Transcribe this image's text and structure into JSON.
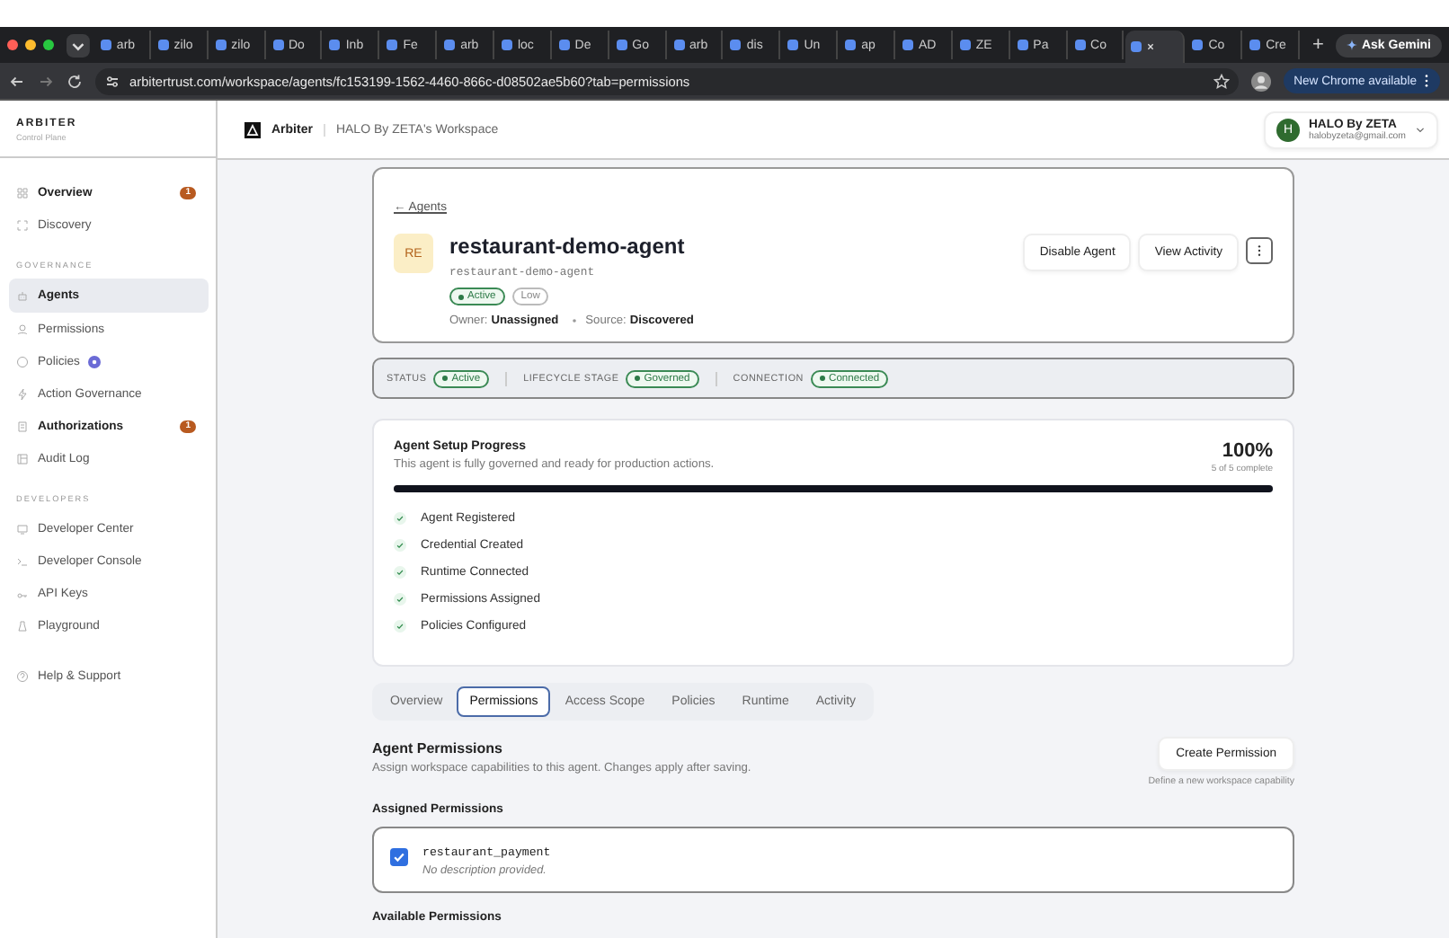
{
  "browser": {
    "tabs": [
      {
        "label": "arb",
        "selected": false
      },
      {
        "label": "zilo",
        "selected": false
      },
      {
        "label": "zilo",
        "selected": false
      },
      {
        "label": "Do",
        "selected": false
      },
      {
        "label": "Inb",
        "selected": false
      },
      {
        "label": "Fe",
        "selected": false
      },
      {
        "label": "arb",
        "selected": false
      },
      {
        "label": "loc",
        "selected": false
      },
      {
        "label": "De",
        "selected": false
      },
      {
        "label": "Go",
        "selected": false
      },
      {
        "label": "arb",
        "selected": false
      },
      {
        "label": "dis",
        "selected": false
      },
      {
        "label": "Un",
        "selected": false
      },
      {
        "label": "ap",
        "selected": false
      },
      {
        "label": "AD",
        "selected": false
      },
      {
        "label": "ZE",
        "selected": false
      },
      {
        "label": "Pa",
        "selected": false
      },
      {
        "label": "Co",
        "selected": false
      },
      {
        "selected": true
      },
      {
        "label": "Co",
        "selected": false
      },
      {
        "label": "Cre",
        "selected": false
      }
    ],
    "new_tab": "+",
    "ask_gemini": "Ask Gemini",
    "url": "arbitertrust.com/workspace/agents/fc153199-1562-4460-866c-d08502ae5b60?tab=permissions",
    "update_button": "New Chrome available"
  },
  "sidebar": {
    "brand": "ARBITER",
    "subtitle": "Control Plane",
    "items": [
      {
        "kind": "item",
        "label": "Overview",
        "selected": false,
        "emphasized": true,
        "badge": {
          "kind": "count",
          "text": "1"
        }
      },
      {
        "kind": "item",
        "label": "Discovery",
        "selected": false,
        "emphasized": false
      },
      {
        "kind": "section",
        "label": "GOVERNANCE"
      },
      {
        "kind": "item",
        "label": "Agents",
        "selected": true,
        "emphasized": true
      },
      {
        "kind": "item",
        "label": "Permissions",
        "selected": false,
        "emphasized": false
      },
      {
        "kind": "item",
        "label": "Policies",
        "selected": false,
        "emphasized": false,
        "badge": {
          "kind": "dot"
        }
      },
      {
        "kind": "item",
        "label": "Action Governance",
        "selected": false,
        "emphasized": false
      },
      {
        "kind": "item",
        "label": "Authorizations",
        "selected": false,
        "emphasized": true,
        "badge": {
          "kind": "count",
          "text": "1"
        }
      },
      {
        "kind": "item",
        "label": "Audit Log",
        "selected": false,
        "emphasized": false
      },
      {
        "kind": "section",
        "label": "DEVELOPERS"
      },
      {
        "kind": "item",
        "label": "Developer Center",
        "selected": false,
        "emphasized": false
      },
      {
        "kind": "item",
        "label": "Developer Console",
        "selected": false,
        "emphasized": false
      },
      {
        "kind": "item",
        "label": "API Keys",
        "selected": false,
        "emphasized": false
      },
      {
        "kind": "item",
        "label": "Playground",
        "selected": false,
        "emphasized": false
      },
      {
        "kind": "gap"
      },
      {
        "kind": "item",
        "label": "Help & Support",
        "selected": false,
        "emphasized": false
      }
    ]
  },
  "header": {
    "logo": "Arbiter",
    "workspace": "HALO By ZETA's Workspace",
    "user": {
      "initial": "H",
      "name": "HALO By ZETA",
      "email": "halobyzeta@gmail.com"
    }
  },
  "agent": {
    "back_link": "← Agents",
    "avatar": "RE",
    "name": "restaurant-demo-agent",
    "slug": "restaurant-demo-agent",
    "badges": [
      {
        "kind": "status",
        "label": "Active"
      },
      {
        "kind": "risk",
        "label": "Low"
      }
    ],
    "owner_label": "Owner:",
    "owner": "Unassigned",
    "source_label": "Source:",
    "source": "Discovered",
    "buttons": [
      "Disable Agent",
      "View Activity"
    ]
  },
  "status_bar": [
    {
      "label": "STATUS",
      "value": "Active"
    },
    {
      "label": "LIFECYCLE STAGE",
      "value": "Governed"
    },
    {
      "label": "CONNECTION",
      "value": "Connected"
    }
  ],
  "progress": {
    "title": "Agent Setup Progress",
    "subtitle": "This agent is fully governed and ready for production actions.",
    "percent": "100%",
    "count": "5 of 5 complete",
    "level": 1,
    "steps": [
      {
        "label": "Agent Registered",
        "done": true
      },
      {
        "label": "Credential Created",
        "done": true
      },
      {
        "label": "Runtime Connected",
        "done": true
      },
      {
        "label": "Permissions Assigned",
        "done": true
      },
      {
        "label": "Policies Configured",
        "done": true
      }
    ]
  },
  "tabs": [
    {
      "label": "Overview",
      "selected": false
    },
    {
      "label": "Permissions",
      "selected": true
    },
    {
      "label": "Access Scope",
      "selected": false
    },
    {
      "label": "Policies",
      "selected": false
    },
    {
      "label": "Runtime",
      "selected": false
    },
    {
      "label": "Activity",
      "selected": false
    }
  ],
  "permissions": {
    "title": "Agent Permissions",
    "description": "Assign workspace capabilities to this agent. Changes apply after saving.",
    "create_button": "Create Permission",
    "create_hint": "Define a new workspace capability",
    "assigned_title": "Assigned Permissions",
    "assigned": [
      {
        "name": "restaurant_payment",
        "description": "No description provided.",
        "checked": true
      }
    ],
    "available_title": "Available Permissions"
  }
}
